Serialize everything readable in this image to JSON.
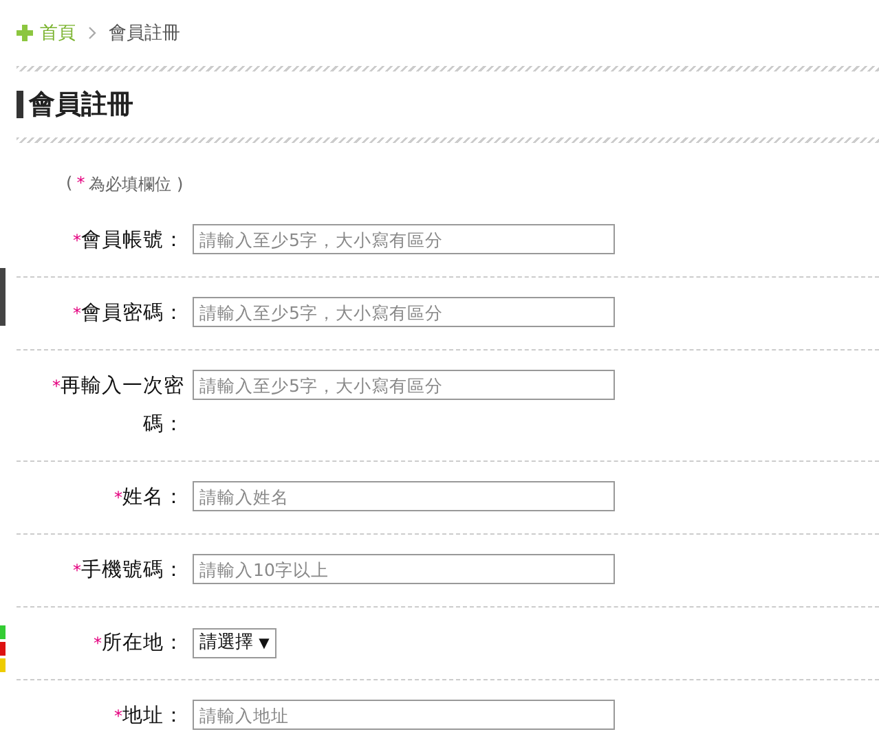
{
  "breadcrumb": [
    {
      "label": "首頁",
      "kind": "home"
    },
    {
      "label": "會員註冊",
      "kind": "current"
    }
  ],
  "title": "會員註冊",
  "note": {
    "open": "(",
    "mark": "*",
    "text": "為必填欄位 )"
  },
  "fields": [
    {
      "label": "會員帳號：",
      "required": true,
      "kind": "text",
      "placeholder": "請輸入至少5字，大小寫有區分"
    },
    {
      "label": "會員密碼：",
      "required": true,
      "kind": "text",
      "placeholder": "請輸入至少5字，大小寫有區分"
    },
    {
      "label": "再輸入一次密碼：",
      "required": true,
      "kind": "text",
      "placeholder": "請輸入至少5字，大小寫有區分"
    },
    {
      "label": "姓名：",
      "required": true,
      "kind": "text",
      "placeholder": "請輸入姓名"
    },
    {
      "label": "手機號碼：",
      "required": true,
      "kind": "text",
      "placeholder": "請輸入10字以上"
    },
    {
      "label": "所在地：",
      "required": true,
      "kind": "select",
      "value": "請選擇",
      "arrow": "▼"
    },
    {
      "label": "地址：",
      "required": true,
      "kind": "text",
      "placeholder": "請輸入地址"
    }
  ]
}
